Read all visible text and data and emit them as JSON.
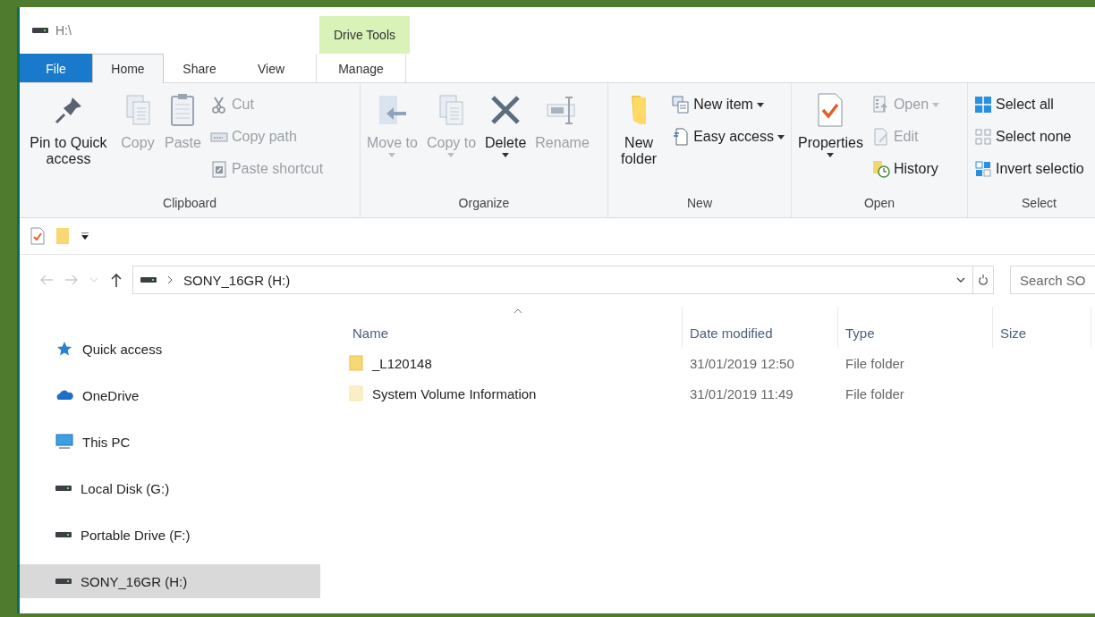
{
  "window": {
    "title": "H:\\"
  },
  "tabs": [
    {
      "label": "File",
      "kind": "file",
      "selected": false
    },
    {
      "label": "Home",
      "kind": "plain",
      "selected": true
    },
    {
      "label": "Share",
      "kind": "plain",
      "selected": false
    },
    {
      "label": "View",
      "kind": "plain",
      "selected": false
    },
    {
      "label": "Manage",
      "kind": "contextual",
      "group": "Drive Tools",
      "selected": false
    }
  ],
  "ribbon": [
    {
      "label": "Clipboard",
      "items": [
        {
          "label": "Pin to Quick access",
          "kind": "large",
          "disabled": false,
          "dropdown": false
        },
        {
          "label": "Copy",
          "kind": "large",
          "disabled": true,
          "dropdown": false
        },
        {
          "label": "Paste",
          "kind": "large",
          "disabled": true,
          "dropdown": false
        },
        {
          "label": "Cut",
          "kind": "small",
          "disabled": true,
          "dropdown": false
        },
        {
          "label": "Copy path",
          "kind": "small",
          "disabled": true,
          "dropdown": false
        },
        {
          "label": "Paste shortcut",
          "kind": "small",
          "disabled": true,
          "dropdown": false
        }
      ]
    },
    {
      "label": "Organize",
      "items": [
        {
          "label": "Move to",
          "kind": "large",
          "disabled": true,
          "dropdown": true
        },
        {
          "label": "Copy to",
          "kind": "large",
          "disabled": true,
          "dropdown": true
        },
        {
          "label": "Delete",
          "kind": "large",
          "disabled": false,
          "dropdown": true
        },
        {
          "label": "Rename",
          "kind": "large",
          "disabled": true,
          "dropdown": false
        }
      ]
    },
    {
      "label": "New",
      "items": [
        {
          "label": "New folder",
          "kind": "large",
          "disabled": false,
          "dropdown": false
        },
        {
          "label": "New item",
          "kind": "small",
          "disabled": false,
          "dropdown": true
        },
        {
          "label": "Easy access",
          "kind": "small",
          "disabled": false,
          "dropdown": true
        }
      ]
    },
    {
      "label": "Open",
      "items": [
        {
          "label": "Properties",
          "kind": "large",
          "disabled": false,
          "dropdown": true
        },
        {
          "label": "Open",
          "kind": "small",
          "disabled": true,
          "dropdown": true
        },
        {
          "label": "Edit",
          "kind": "small",
          "disabled": true,
          "dropdown": false
        },
        {
          "label": "History",
          "kind": "small",
          "disabled": false,
          "dropdown": false
        }
      ]
    },
    {
      "label": "Select",
      "items": [
        {
          "label": "Select all",
          "kind": "small",
          "disabled": false,
          "dropdown": false
        },
        {
          "label": "Select none",
          "kind": "small",
          "disabled": false,
          "dropdown": false
        },
        {
          "label": "Invert selectio",
          "kind": "small",
          "disabled": false,
          "dropdown": false
        }
      ]
    }
  ],
  "address": {
    "back_disabled": true,
    "forward_disabled": true,
    "path": "SONY_16GR (H:)",
    "search_placeholder": "Search SO"
  },
  "sidebar": {
    "items": [
      {
        "label": "Quick access",
        "selected": false
      },
      {
        "label": "OneDrive",
        "selected": false
      },
      {
        "label": "This PC",
        "selected": false
      },
      {
        "label": "Local Disk (G:)",
        "selected": false
      },
      {
        "label": "Portable Drive (F:)",
        "selected": false
      },
      {
        "label": "SONY_16GR (H:)",
        "selected": true
      }
    ]
  },
  "table": {
    "columns": [
      {
        "label": "Name",
        "sorted": true
      },
      {
        "label": "Date modified",
        "sorted": false
      },
      {
        "label": "Type",
        "sorted": false
      },
      {
        "label": "Size",
        "sorted": false
      }
    ],
    "rows": [
      {
        "name": "_L120148",
        "date_modified": "31/01/2019 12:50",
        "type": "File folder",
        "hidden": false
      },
      {
        "name": "System Volume Information",
        "date_modified": "31/01/2019 11:49",
        "type": "File folder",
        "hidden": true
      }
    ]
  }
}
